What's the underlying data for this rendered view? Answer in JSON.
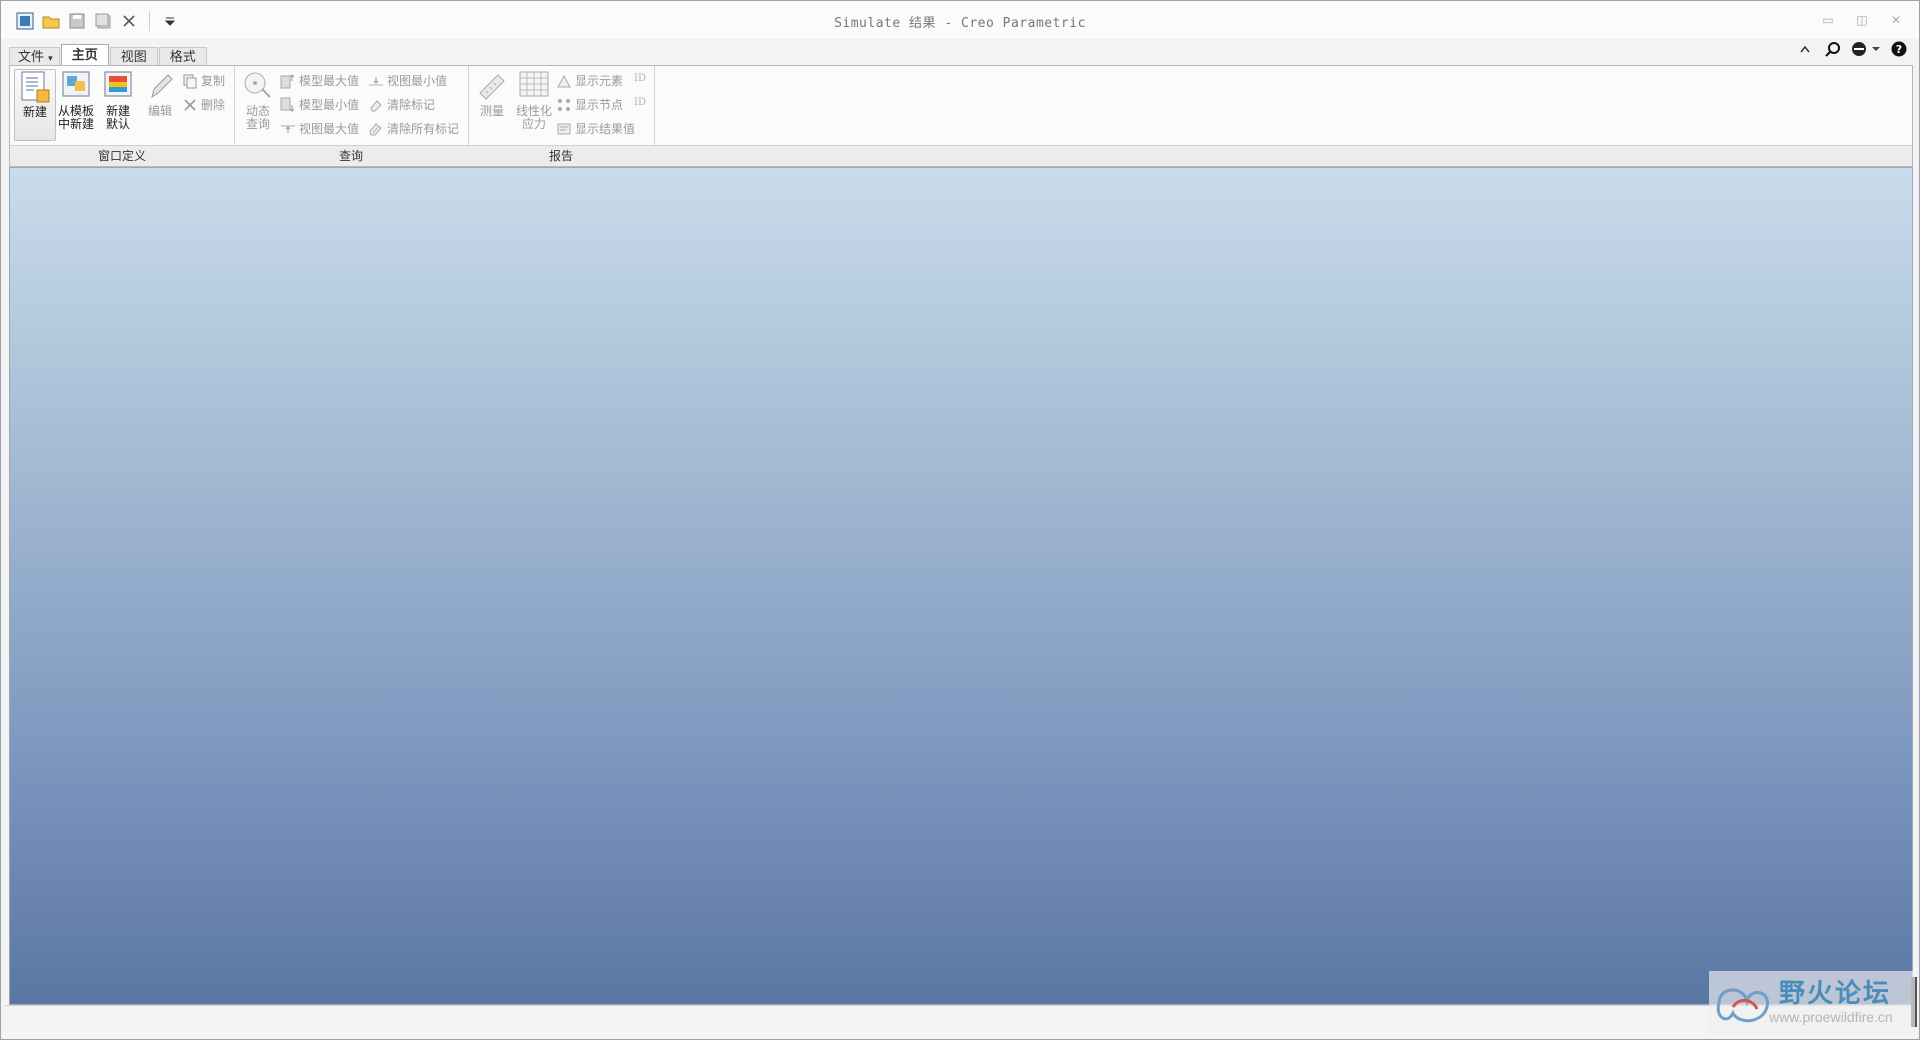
{
  "window": {
    "title": "Simulate 结果 - Creo Parametric"
  },
  "tabs": [
    {
      "label": "文件",
      "suffix": "▾"
    },
    {
      "label": "主页"
    },
    {
      "label": "视图"
    },
    {
      "label": "格式"
    }
  ],
  "groups": {
    "window_def": {
      "label": "窗口定义",
      "new": "新建",
      "from_template_1": "从模板",
      "from_template_2": "中新建",
      "new_default_1": "新建",
      "new_default_2": "默认",
      "edit": "编辑",
      "copy": "复制",
      "delete": "删除"
    },
    "query": {
      "label": "查询",
      "dynamic_1": "动态",
      "dynamic_2": "查询",
      "model_max": "模型最大值",
      "model_min": "模型最小值",
      "view_max": "视图最大值",
      "view_min": "视图最小值",
      "clear_mark": "清除标记",
      "clear_all_marks": "清除所有标记"
    },
    "report": {
      "label": "报告",
      "measure": "测量",
      "linearized_1": "线性化",
      "linearized_2": "应力",
      "show_elements": "显示元素",
      "show_nodes": "显示节点",
      "show_results": "显示结果值",
      "id_tag": "ID"
    }
  },
  "watermark": {
    "text": "野火论坛",
    "url": "www.proewildfire.cn"
  }
}
